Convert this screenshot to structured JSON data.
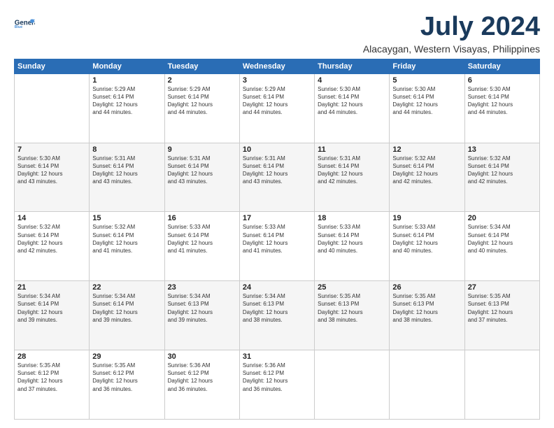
{
  "header": {
    "logo_general": "General",
    "logo_blue": "Blue",
    "title": "July 2024",
    "subtitle": "Alacaygan, Western Visayas, Philippines"
  },
  "days_of_week": [
    "Sunday",
    "Monday",
    "Tuesday",
    "Wednesday",
    "Thursday",
    "Friday",
    "Saturday"
  ],
  "weeks": [
    {
      "shade": false,
      "cells": [
        {
          "day": null,
          "info": null
        },
        {
          "day": "1",
          "info": "Sunrise: 5:29 AM\nSunset: 6:14 PM\nDaylight: 12 hours\nand 44 minutes."
        },
        {
          "day": "2",
          "info": "Sunrise: 5:29 AM\nSunset: 6:14 PM\nDaylight: 12 hours\nand 44 minutes."
        },
        {
          "day": "3",
          "info": "Sunrise: 5:29 AM\nSunset: 6:14 PM\nDaylight: 12 hours\nand 44 minutes."
        },
        {
          "day": "4",
          "info": "Sunrise: 5:30 AM\nSunset: 6:14 PM\nDaylight: 12 hours\nand 44 minutes."
        },
        {
          "day": "5",
          "info": "Sunrise: 5:30 AM\nSunset: 6:14 PM\nDaylight: 12 hours\nand 44 minutes."
        },
        {
          "day": "6",
          "info": "Sunrise: 5:30 AM\nSunset: 6:14 PM\nDaylight: 12 hours\nand 44 minutes."
        }
      ]
    },
    {
      "shade": true,
      "cells": [
        {
          "day": "7",
          "info": "Sunrise: 5:30 AM\nSunset: 6:14 PM\nDaylight: 12 hours\nand 43 minutes."
        },
        {
          "day": "8",
          "info": "Sunrise: 5:31 AM\nSunset: 6:14 PM\nDaylight: 12 hours\nand 43 minutes."
        },
        {
          "day": "9",
          "info": "Sunrise: 5:31 AM\nSunset: 6:14 PM\nDaylight: 12 hours\nand 43 minutes."
        },
        {
          "day": "10",
          "info": "Sunrise: 5:31 AM\nSunset: 6:14 PM\nDaylight: 12 hours\nand 43 minutes."
        },
        {
          "day": "11",
          "info": "Sunrise: 5:31 AM\nSunset: 6:14 PM\nDaylight: 12 hours\nand 42 minutes."
        },
        {
          "day": "12",
          "info": "Sunrise: 5:32 AM\nSunset: 6:14 PM\nDaylight: 12 hours\nand 42 minutes."
        },
        {
          "day": "13",
          "info": "Sunrise: 5:32 AM\nSunset: 6:14 PM\nDaylight: 12 hours\nand 42 minutes."
        }
      ]
    },
    {
      "shade": false,
      "cells": [
        {
          "day": "14",
          "info": "Sunrise: 5:32 AM\nSunset: 6:14 PM\nDaylight: 12 hours\nand 42 minutes."
        },
        {
          "day": "15",
          "info": "Sunrise: 5:32 AM\nSunset: 6:14 PM\nDaylight: 12 hours\nand 41 minutes."
        },
        {
          "day": "16",
          "info": "Sunrise: 5:33 AM\nSunset: 6:14 PM\nDaylight: 12 hours\nand 41 minutes."
        },
        {
          "day": "17",
          "info": "Sunrise: 5:33 AM\nSunset: 6:14 PM\nDaylight: 12 hours\nand 41 minutes."
        },
        {
          "day": "18",
          "info": "Sunrise: 5:33 AM\nSunset: 6:14 PM\nDaylight: 12 hours\nand 40 minutes."
        },
        {
          "day": "19",
          "info": "Sunrise: 5:33 AM\nSunset: 6:14 PM\nDaylight: 12 hours\nand 40 minutes."
        },
        {
          "day": "20",
          "info": "Sunrise: 5:34 AM\nSunset: 6:14 PM\nDaylight: 12 hours\nand 40 minutes."
        }
      ]
    },
    {
      "shade": true,
      "cells": [
        {
          "day": "21",
          "info": "Sunrise: 5:34 AM\nSunset: 6:14 PM\nDaylight: 12 hours\nand 39 minutes."
        },
        {
          "day": "22",
          "info": "Sunrise: 5:34 AM\nSunset: 6:14 PM\nDaylight: 12 hours\nand 39 minutes."
        },
        {
          "day": "23",
          "info": "Sunrise: 5:34 AM\nSunset: 6:13 PM\nDaylight: 12 hours\nand 39 minutes."
        },
        {
          "day": "24",
          "info": "Sunrise: 5:34 AM\nSunset: 6:13 PM\nDaylight: 12 hours\nand 38 minutes."
        },
        {
          "day": "25",
          "info": "Sunrise: 5:35 AM\nSunset: 6:13 PM\nDaylight: 12 hours\nand 38 minutes."
        },
        {
          "day": "26",
          "info": "Sunrise: 5:35 AM\nSunset: 6:13 PM\nDaylight: 12 hours\nand 38 minutes."
        },
        {
          "day": "27",
          "info": "Sunrise: 5:35 AM\nSunset: 6:13 PM\nDaylight: 12 hours\nand 37 minutes."
        }
      ]
    },
    {
      "shade": false,
      "cells": [
        {
          "day": "28",
          "info": "Sunrise: 5:35 AM\nSunset: 6:12 PM\nDaylight: 12 hours\nand 37 minutes."
        },
        {
          "day": "29",
          "info": "Sunrise: 5:35 AM\nSunset: 6:12 PM\nDaylight: 12 hours\nand 36 minutes."
        },
        {
          "day": "30",
          "info": "Sunrise: 5:36 AM\nSunset: 6:12 PM\nDaylight: 12 hours\nand 36 minutes."
        },
        {
          "day": "31",
          "info": "Sunrise: 5:36 AM\nSunset: 6:12 PM\nDaylight: 12 hours\nand 36 minutes."
        },
        {
          "day": null,
          "info": null
        },
        {
          "day": null,
          "info": null
        },
        {
          "day": null,
          "info": null
        }
      ]
    }
  ]
}
